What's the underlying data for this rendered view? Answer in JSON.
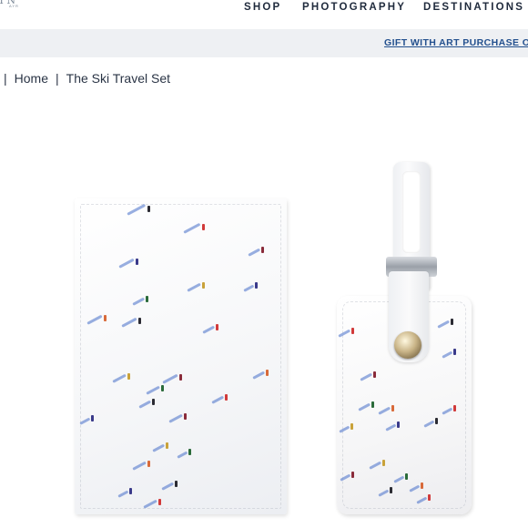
{
  "header": {
    "logo_letters": "TN",
    "logo_tag": "AYR",
    "nav": [
      "SHOP",
      "PHOTOGRAPHY",
      "DESTINATIONS"
    ]
  },
  "promo": {
    "text": "GIFT WITH ART PURCHASE OVE"
  },
  "breadcrumb": {
    "items": [
      "Home",
      "The Ski Travel Set"
    ],
    "separator": "|"
  },
  "product": {
    "items": [
      {
        "name": "passport-cover"
      },
      {
        "name": "luggage-tag"
      }
    ]
  },
  "colors": {
    "accent_link": "#23508e",
    "text_dark": "#1f2a3c",
    "promo_bg": "#eef0f3",
    "skier_shadow": "#5a82c8",
    "skier_red": "#d13a3a",
    "skier_dark": "#2b2b33"
  }
}
